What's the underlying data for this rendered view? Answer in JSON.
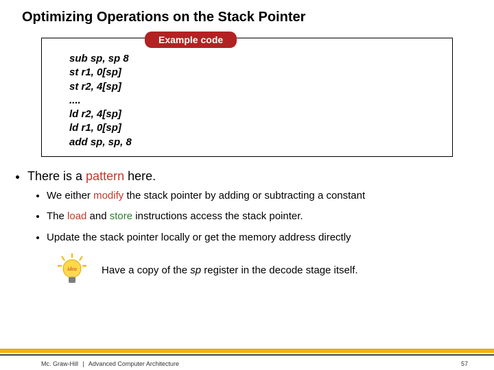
{
  "title": "Optimizing Operations on the Stack Pointer",
  "example": {
    "label": "Example code",
    "code": "sub sp, sp 8\nst r1, 0[sp]\nst r2, 4[sp]\n....\nld r2, 4[sp]\nld r1, 0[sp]\nadd sp, sp, 8"
  },
  "main_bullet": {
    "pre": "There is a ",
    "highlight": "pattern",
    "post": " here."
  },
  "subs": {
    "s1": {
      "a": "We either ",
      "b": "modify",
      "c": " the stack pointer by adding or subtracting a constant"
    },
    "s2": {
      "a": "The ",
      "b": "load",
      "c": " and ",
      "d": "store",
      "e": " instructions access the stack pointer."
    },
    "s3": "Update the stack pointer locally or get the memory address directly"
  },
  "idea": {
    "pre": "Have a copy of the ",
    "em": "sp",
    "post": " register in the decode stage itself."
  },
  "footer": {
    "publisher": "Mc. Graw-Hill",
    "book": "Advanced Computer Architecture",
    "page": "57"
  }
}
